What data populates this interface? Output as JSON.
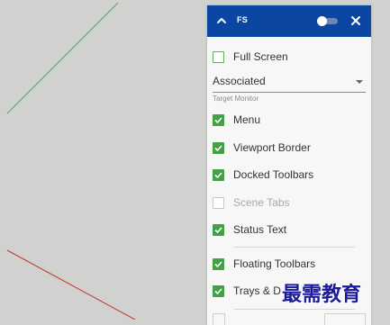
{
  "panel": {
    "title": "FS",
    "header_color": "#0b46a3",
    "collapse_icon": "chevron-up-icon",
    "close_icon": "close-icon",
    "toggle_on": false
  },
  "options": {
    "full_screen": {
      "label": "Full Screen",
      "checked": false
    },
    "target_monitor": {
      "value": "Associated",
      "caption": "Target Monitor"
    },
    "menu": {
      "label": "Menu",
      "checked": true
    },
    "viewport_border": {
      "label": "Viewport Border",
      "checked": true
    },
    "docked_toolbars": {
      "label": "Docked Toolbars",
      "checked": true
    },
    "scene_tabs": {
      "label": "Scene Tabs",
      "checked": false,
      "disabled": true
    },
    "status_text": {
      "label": "Status Text",
      "checked": true
    },
    "floating_toolbars": {
      "label": "Floating Toolbars",
      "checked": true
    },
    "trays_dialogs": {
      "label": "Trays & D",
      "checked": true
    }
  },
  "watermark": {
    "text": "最需教育"
  },
  "colors": {
    "check_green": "#43a047",
    "viewport_bg": "#d1d1cf",
    "axis_green": "#4caf50",
    "axis_red": "#c0392b"
  }
}
